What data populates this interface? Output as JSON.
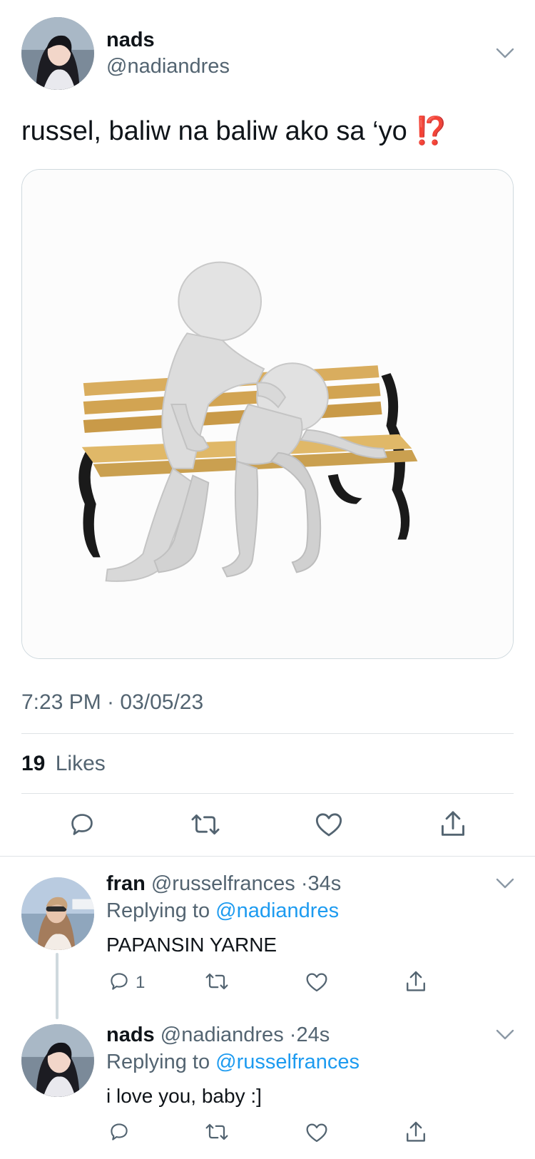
{
  "main_tweet": {
    "author_name": "nads",
    "author_handle": "@nadiandres",
    "text": "russel, baliw na baliw ako sa ‘yo",
    "emoji": "⁉️",
    "media_description": "3D white figure comforting another figure crying on a wooden park bench",
    "timestamp": "7:23 PM · 03/05/23",
    "likes_count": "19",
    "likes_label": "Likes",
    "actions": [
      "reply-icon",
      "retweet-icon",
      "like-icon",
      "share-icon"
    ]
  },
  "replies": [
    {
      "author_name": "fran",
      "author_handle": "@russelfrances",
      "separator": "·",
      "time": "34s",
      "replying_prefix": "Replying to",
      "replying_to": "@nadiandres",
      "text": "PAPANSIN YARNE",
      "reply_count": "1"
    },
    {
      "author_name": "nads",
      "author_handle": "@nadiandres",
      "separator": "·",
      "time": "24s",
      "replying_prefix": "Replying to",
      "replying_to": "@russelfrances",
      "text": "i love you, baby :]",
      "reply_count": ""
    }
  ],
  "colors": {
    "text_primary": "#0f1419",
    "text_secondary": "#536471",
    "link": "#1d9bf0",
    "divider": "#dfe3e6",
    "emoji_red": "#e0301e"
  }
}
